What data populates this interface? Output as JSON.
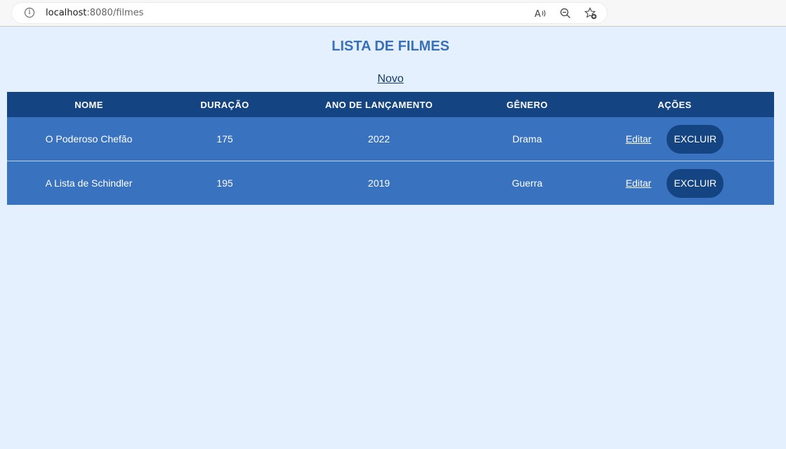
{
  "browser": {
    "url_host": "localhost",
    "url_path": ":8080/filmes",
    "icons": [
      "info-icon",
      "read-aloud-icon",
      "zoom-out-icon",
      "add-favorite-icon"
    ]
  },
  "page": {
    "title": "LISTA DE FILMES",
    "new_link": "Novo"
  },
  "table": {
    "headers": [
      "NOME",
      "DURAÇÃO",
      "ANO DE LANÇAMENTO",
      "GÊNERO",
      "AÇÕES"
    ],
    "rows": [
      {
        "nome": "O Poderoso Chefão",
        "duracao": "175",
        "ano": "2022",
        "genero": "Drama",
        "edit_label": "Editar",
        "delete_label": "EXCLUIR"
      },
      {
        "nome": "A Lista de Schindler",
        "duracao": "195",
        "ano": "2019",
        "genero": "Guerra",
        "edit_label": "Editar",
        "delete_label": "EXCLUIR"
      }
    ]
  },
  "colors": {
    "background": "#e4f0fe",
    "title": "#3a70b8",
    "header_bg": "#144481",
    "row_bg": "#3972bf",
    "button_bg": "#144481"
  }
}
